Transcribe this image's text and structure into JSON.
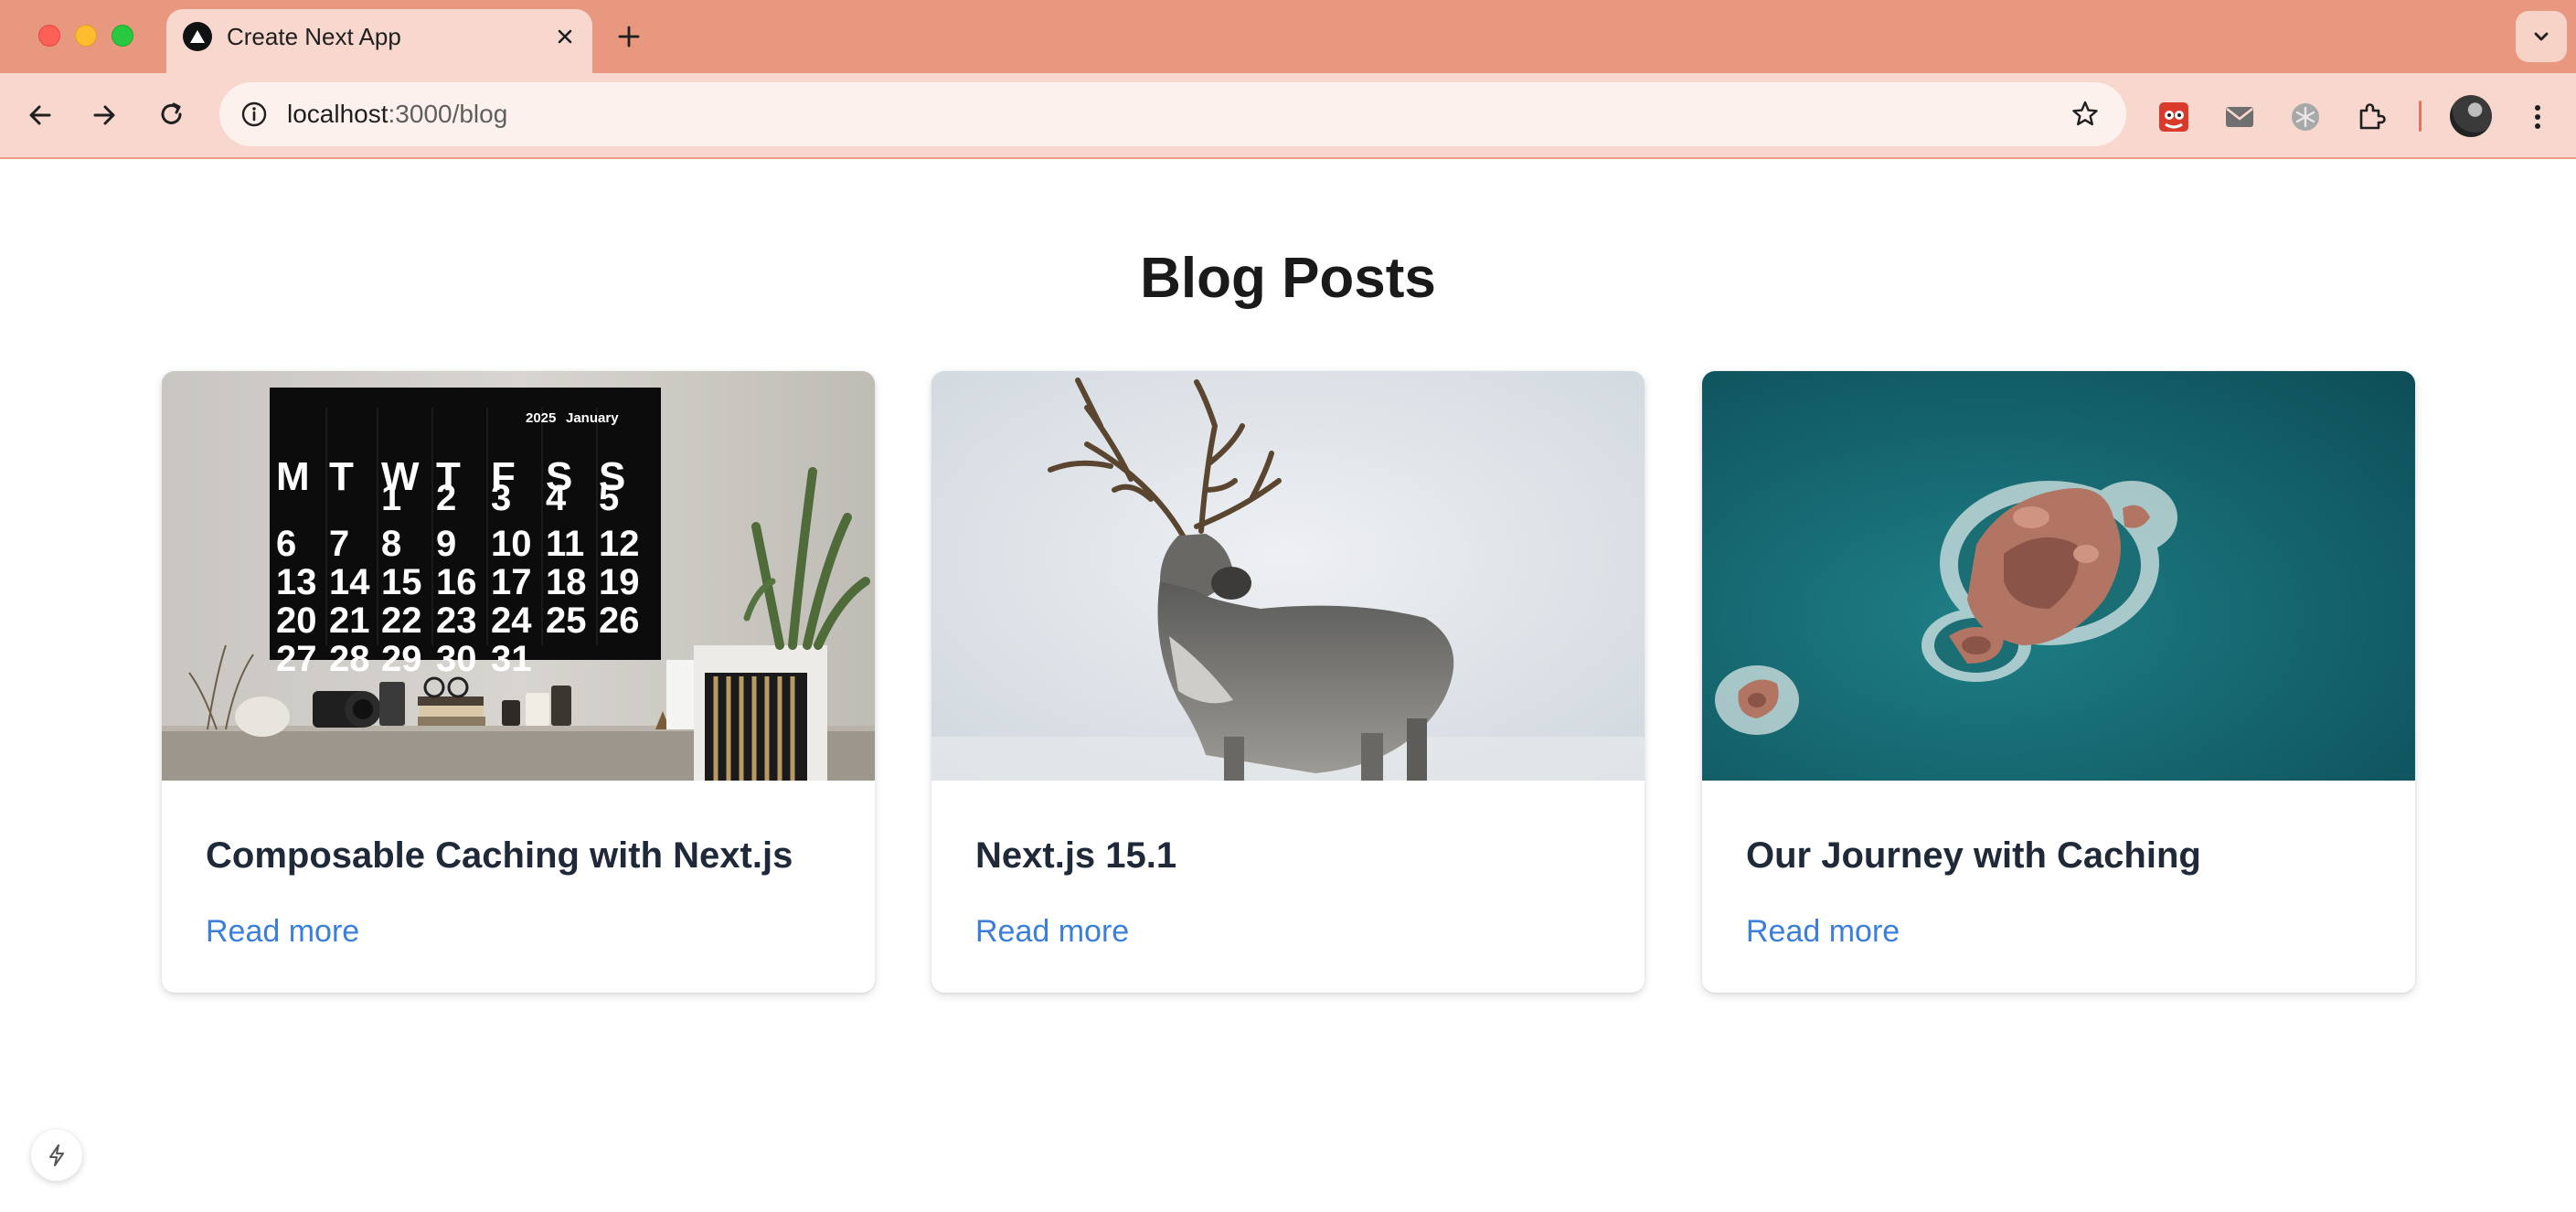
{
  "browser": {
    "tab": {
      "title": "Create Next App",
      "favicon": "triangle-favicon-icon"
    },
    "address": {
      "host": "localhost",
      "path": ":3000/blog"
    },
    "colors": {
      "tabstrip": "#e8987f",
      "toolbar": "#f8d8ce",
      "omnibox": "#fdf1ed"
    }
  },
  "page": {
    "title": "Blog Posts",
    "posts": [
      {
        "title": "Composable Caching with Next.js",
        "link": "Read more",
        "image": "calendar-desk-photo"
      },
      {
        "title": "Next.js 15.1",
        "link": "Read more",
        "image": "reindeer-photo"
      },
      {
        "title": "Our Journey with Caching",
        "link": "Read more",
        "image": "ocean-rocks-aerial-photo"
      }
    ],
    "calendar": {
      "year": "2025",
      "month": "January",
      "days": [
        "M",
        "T",
        "W",
        "T",
        "F",
        "S",
        "S"
      ],
      "weeks": [
        [
          "",
          "",
          "1",
          "2",
          "3",
          "4",
          "5"
        ],
        [
          "6",
          "7",
          "8",
          "9",
          "10",
          "11",
          "12"
        ],
        [
          "13",
          "14",
          "15",
          "16",
          "17",
          "18",
          "19"
        ],
        [
          "20",
          "21",
          "22",
          "23",
          "24",
          "25",
          "26"
        ],
        [
          "27",
          "28",
          "29",
          "30",
          "31",
          "",
          ""
        ]
      ]
    }
  },
  "link_color": "#3b7fdb"
}
